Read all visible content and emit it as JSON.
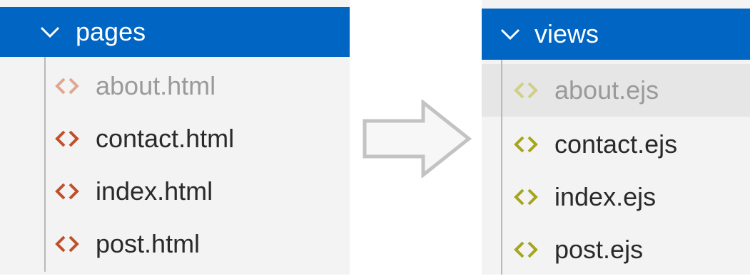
{
  "left_panel": {
    "folder_name": "pages",
    "files": [
      {
        "name": "about.html",
        "dimmed": true
      },
      {
        "name": "contact.html",
        "dimmed": false
      },
      {
        "name": "index.html",
        "dimmed": false
      },
      {
        "name": "post.html",
        "dimmed": false
      }
    ],
    "icon_color": "#c0502a",
    "icon_color_dim": "#e0a790"
  },
  "right_panel": {
    "folder_name": "views",
    "files": [
      {
        "name": "about.ejs",
        "dimmed": true
      },
      {
        "name": "contact.ejs",
        "dimmed": false
      },
      {
        "name": "index.ejs",
        "dimmed": false
      },
      {
        "name": "post.ejs",
        "dimmed": false
      }
    ],
    "icon_color": "#a5a51e",
    "icon_color_dim": "#cfcf86"
  },
  "colors": {
    "header_bg": "#0065c3",
    "panel_bg": "#f3f3f3",
    "arrow_fill": "#f7f7f7",
    "arrow_stroke": "#c3c3c3"
  },
  "icons": {
    "chevron": "chevron-down-icon",
    "file": "code-file-icon",
    "arrow": "arrow-right-icon"
  }
}
